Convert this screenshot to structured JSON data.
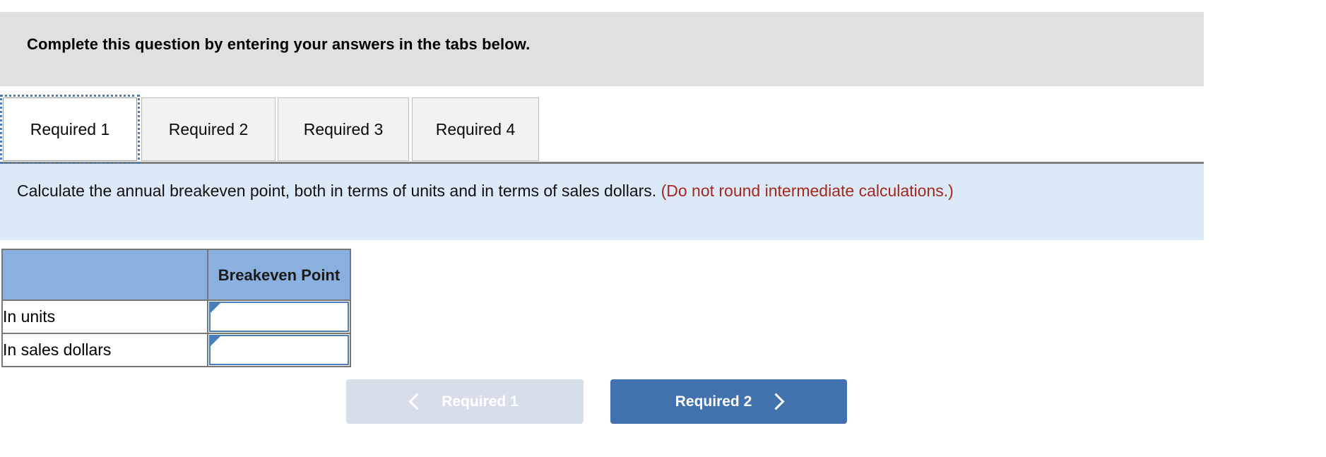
{
  "banner": {
    "text": "Complete this question by entering your answers in the tabs below."
  },
  "tabs": [
    {
      "label": "Required 1",
      "active": true
    },
    {
      "label": "Required 2",
      "active": false
    },
    {
      "label": "Required 3",
      "active": false
    },
    {
      "label": "Required 4",
      "active": false
    }
  ],
  "requirement": {
    "text": "Calculate the annual breakeven point, both in terms of units and in terms of sales dollars. ",
    "note": "(Do not round intermediate calculations.)"
  },
  "answer_table": {
    "corner_header": "",
    "value_header": "Breakeven Point",
    "rows": [
      {
        "label": "In units",
        "value": "",
        "placeholder": ""
      },
      {
        "label": "In sales dollars",
        "value": "",
        "placeholder": ""
      }
    ]
  },
  "nav": {
    "prev_label": "Required 1",
    "next_label": "Required 2",
    "prev_icon": "chevron-left-icon",
    "next_icon": "chevron-right-icon"
  },
  "colors": {
    "banner_bg": "#e0e0e0",
    "panel_bg": "#dce9f7",
    "note_red": "#a32820",
    "table_header_blue": "#8ab0e0",
    "input_border_blue": "#4a7ebb",
    "next_button_blue": "#4272ae",
    "prev_button_disabled": "#d6deea",
    "tab_inactive_bg": "#f2f2f2"
  }
}
